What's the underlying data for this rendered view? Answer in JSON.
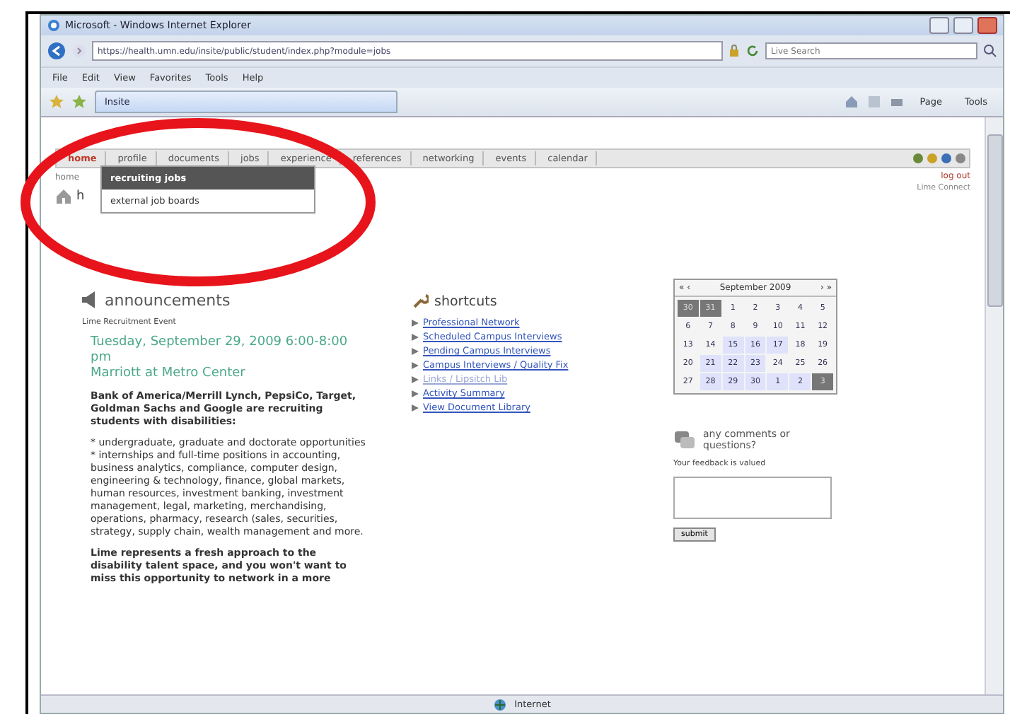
{
  "browser": {
    "title": "Microsoft - Windows Internet Explorer",
    "address": "https://health.umn.edu/insite/public/student/index.php?module=jobs",
    "search_placeholder": "Live Search",
    "menu": [
      "File",
      "Edit",
      "View",
      "Favorites",
      "Tools",
      "Help"
    ],
    "tab": "Insite",
    "commands": [
      "Page",
      "Tools"
    ],
    "status": "Internet"
  },
  "site_nav": {
    "tabs": [
      {
        "label": "home",
        "selected": true
      },
      {
        "label": "profile",
        "selected": false
      },
      {
        "label": "documents",
        "selected": false
      },
      {
        "label": "jobs",
        "selected": false
      },
      {
        "label": "experience",
        "selected": false
      },
      {
        "label": "references",
        "selected": false
      },
      {
        "label": "networking",
        "selected": false
      },
      {
        "label": "events",
        "selected": false
      },
      {
        "label": "calendar",
        "selected": false
      }
    ],
    "logout": "log out",
    "brand": "Lime Connect"
  },
  "breadcrumb": "home",
  "heading": "h",
  "dropdown": [
    {
      "label": "recruiting jobs",
      "selected": true
    },
    {
      "label": "external job boards",
      "selected": false
    }
  ],
  "announcements": {
    "title": "announcements",
    "event_label": "Lime Recruitment Event",
    "event_lines": [
      "Tuesday, September 29, 2009 6:00-8:00 pm",
      "Marriott at Metro Center"
    ],
    "intro": "Bank of America/Merrill Lynch, PepsiCo, Target, Goldman Sachs and Google are recruiting students with disabilities:",
    "points": [
      "* undergraduate, graduate and doctorate opportunities",
      "* internships and full-time positions in accounting, business analytics, compliance, computer design, engineering & technology, finance, global markets, human resources, investment banking, investment management, legal, marketing, merchandising, operations, pharmacy, research (sales, securities, strategy, supply chain, wealth management and more."
    ],
    "closing": "Lime represents a fresh approach to the disability talent space, and you won't want to miss this opportunity to network in a more"
  },
  "shortcuts": {
    "title": "shortcuts",
    "links": [
      {
        "label": "Professional Network",
        "disabled": false
      },
      {
        "label": "Scheduled Campus Interviews",
        "disabled": false
      },
      {
        "label": "Pending Campus Interviews",
        "disabled": false
      },
      {
        "label": "Campus Interviews / Quality Fix",
        "disabled": false
      },
      {
        "label": "Links / Lipsitch Lib",
        "disabled": true
      },
      {
        "label": "Activity Summary",
        "disabled": false
      },
      {
        "label": "View Document Library",
        "disabled": false
      }
    ]
  },
  "calendar": {
    "title": "September 2009",
    "prev": "« ‹",
    "next": "› »",
    "days": [
      {
        "day": "30",
        "kind": "muted"
      },
      {
        "day": "31",
        "kind": "muted"
      },
      {
        "day": "1",
        "kind": "normal"
      },
      {
        "day": "2",
        "kind": "normal"
      },
      {
        "day": "3",
        "kind": "normal"
      },
      {
        "day": "4",
        "kind": "normal"
      },
      {
        "day": "5",
        "kind": "normal"
      },
      {
        "day": "6",
        "kind": "normal"
      },
      {
        "day": "7",
        "kind": "normal"
      },
      {
        "day": "8",
        "kind": "normal"
      },
      {
        "day": "9",
        "kind": "normal"
      },
      {
        "day": "10",
        "kind": "normal"
      },
      {
        "day": "11",
        "kind": "normal"
      },
      {
        "day": "12",
        "kind": "normal"
      },
      {
        "day": "13",
        "kind": "normal"
      },
      {
        "day": "14",
        "kind": "normal"
      },
      {
        "day": "15",
        "kind": "highlight"
      },
      {
        "day": "16",
        "kind": "highlight"
      },
      {
        "day": "17",
        "kind": "highlight"
      },
      {
        "day": "18",
        "kind": "normal"
      },
      {
        "day": "19",
        "kind": "normal"
      },
      {
        "day": "20",
        "kind": "normal"
      },
      {
        "day": "21",
        "kind": "highlight"
      },
      {
        "day": "22",
        "kind": "highlight"
      },
      {
        "day": "23",
        "kind": "highlight"
      },
      {
        "day": "24",
        "kind": "normal"
      },
      {
        "day": "25",
        "kind": "normal"
      },
      {
        "day": "26",
        "kind": "normal"
      },
      {
        "day": "27",
        "kind": "normal"
      },
      {
        "day": "28",
        "kind": "highlight"
      },
      {
        "day": "29",
        "kind": "highlight"
      },
      {
        "day": "30",
        "kind": "highlight"
      },
      {
        "day": "1",
        "kind": "highlight"
      },
      {
        "day": "2",
        "kind": "highlight"
      },
      {
        "day": "3",
        "kind": "muted"
      }
    ]
  },
  "feedback": {
    "title": "any comments or questions?",
    "label": "Your feedback is valued",
    "button": "submit"
  }
}
